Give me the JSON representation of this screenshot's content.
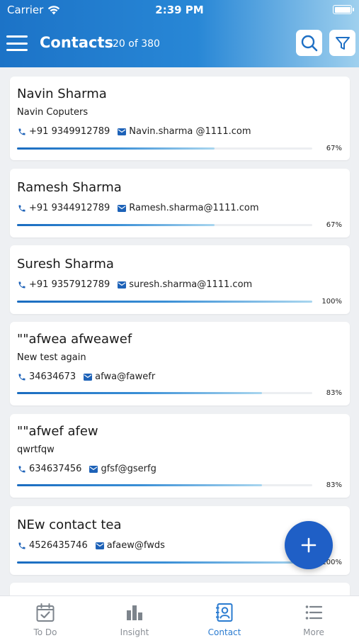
{
  "status_bar": {
    "carrier": "Carrier",
    "time": "2:39 PM"
  },
  "header": {
    "title": "Contacts",
    "count": "20 of 380"
  },
  "contacts": [
    {
      "name": "Navin Sharma",
      "company": "Navin Coputers",
      "phone": "+91 9349912789",
      "email": "Navin.sharma @1111.com",
      "progress": 67,
      "progress_label": "67%"
    },
    {
      "name": "Ramesh Sharma",
      "company": "",
      "phone": "+91 9344912789",
      "email": "Ramesh.sharma@1111.com",
      "progress": 67,
      "progress_label": "67%"
    },
    {
      "name": "Suresh Sharma",
      "company": "",
      "phone": "+91 9357912789",
      "email": "suresh.sharma@1111.com",
      "progress": 100,
      "progress_label": "100%"
    },
    {
      "name": "\"\"afwea afweawef",
      "company": "New test again",
      "phone": "34634673",
      "email": "afwa@fawefr",
      "progress": 83,
      "progress_label": "83%"
    },
    {
      "name": "\"\"afwef afew",
      "company": "qwrtfqw",
      "phone": "634637456",
      "email": "gfsf@gserfg",
      "progress": 83,
      "progress_label": "83%"
    },
    {
      "name": "NEw contact tea",
      "company": "",
      "phone": "4526435746",
      "email": "afaew@fwds",
      "progress": 100,
      "progress_label": "100%"
    }
  ],
  "tabs": [
    {
      "label": "To Do",
      "icon": "calendar-check-icon"
    },
    {
      "label": "Insight",
      "icon": "bar-chart-icon"
    },
    {
      "label": "Contact",
      "icon": "contact-book-icon",
      "active": true
    },
    {
      "label": "More",
      "icon": "list-icon"
    }
  ],
  "colors": {
    "accent": "#1f5fc6",
    "header_start": "#1c73c7",
    "header_end": "#9fd0ee",
    "active_tab": "#2a7bd0",
    "inactive_tab": "#8a8f96"
  }
}
